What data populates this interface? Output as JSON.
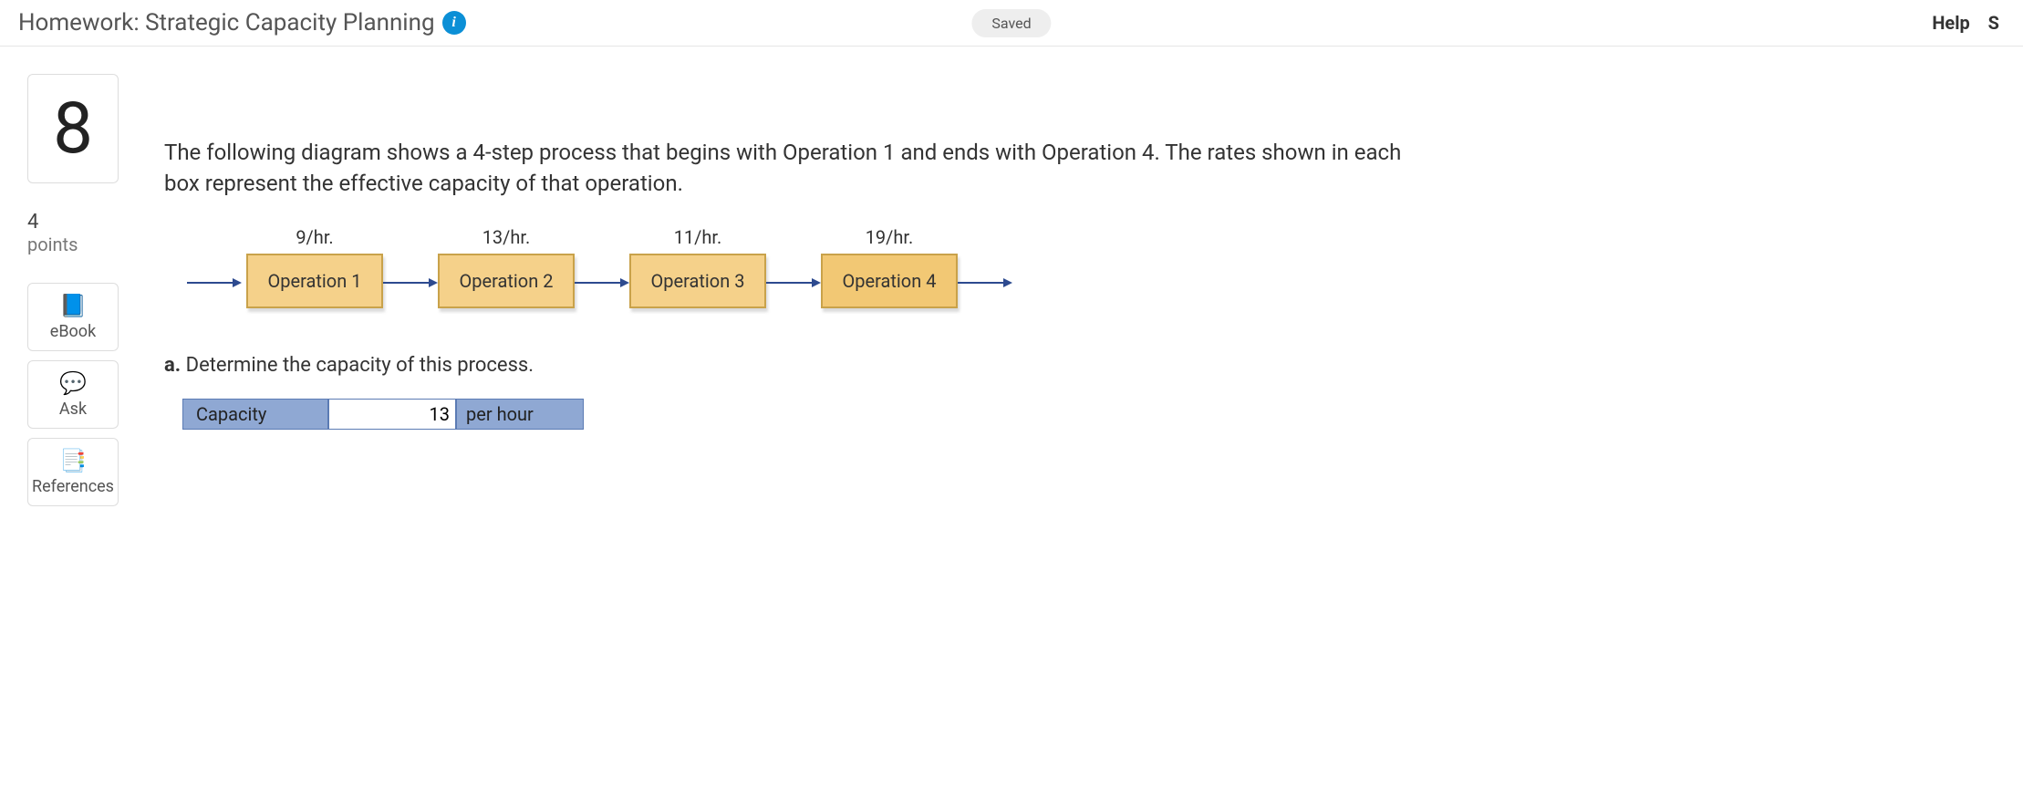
{
  "header": {
    "title": "Homework: Strategic Capacity Planning",
    "info_glyph": "i",
    "saved_label": "Saved",
    "help_label": "Help",
    "truncated_right": "S"
  },
  "sidebar": {
    "question_number": "8",
    "points_value": "4",
    "points_label": "points",
    "tools": [
      {
        "name": "ebook",
        "label": "eBook",
        "icon": "📘"
      },
      {
        "name": "ask",
        "label": "Ask",
        "icon": "💬"
      },
      {
        "name": "references",
        "label": "References",
        "icon": "📑"
      }
    ]
  },
  "problem": {
    "text": "The following diagram shows a 4-step process that begins with Operation 1 and ends with Operation 4. The rates shown in each box represent the effective capacity of that operation.",
    "operations": [
      {
        "rate": "9/hr.",
        "label": "Operation 1"
      },
      {
        "rate": "13/hr.",
        "label": "Operation 2"
      },
      {
        "rate": "11/hr.",
        "label": "Operation 3"
      },
      {
        "rate": "19/hr.",
        "label": "Operation 4"
      }
    ],
    "part_a_prefix": "a.",
    "part_a_text": "Determine the capacity of this process.",
    "answer": {
      "label": "Capacity",
      "value": "13",
      "unit": "per hour"
    }
  }
}
